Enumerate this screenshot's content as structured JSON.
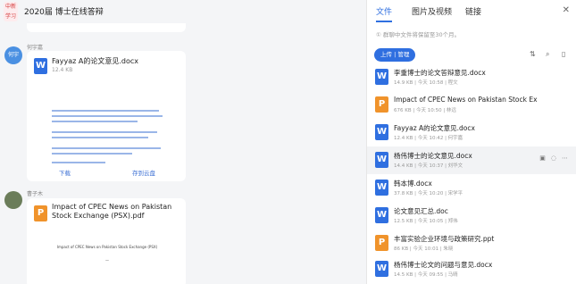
{
  "chat": {
    "group_avatar_text": "中新\n学习",
    "title": "2020届 博士在线答辩",
    "messages": [
      {
        "sender": "何宇嘉",
        "avatar_text": "何宇",
        "avatar_color": "#4a90e2",
        "file": {
          "type": "W",
          "name": "Fayyaz A的论文意见.docx",
          "size": "12.4 KB",
          "actions": [
            "下载",
            "存到云盘"
          ]
        }
      },
      {
        "sender": "曹子木",
        "avatar_color": "#6b7d5a",
        "file": {
          "type": "P",
          "name": "Impact of CPEC News on Pakistan Stock Exchange (PSX).pdf",
          "size": "",
          "preview_title": "Impact of CPEC News on Pakistan Stock Exchange (PSX)"
        }
      }
    ]
  },
  "panel": {
    "tabs": [
      "文件",
      "图片及视频",
      "链接"
    ],
    "active_tab": "文件",
    "notice": "① 群聊中文件将保留至30个月。",
    "upload_label": "上传 | 管理",
    "colors": {
      "accent": "#2f6fe0",
      "word": "#2f6fe0",
      "pdf": "#f0932b"
    },
    "files": [
      {
        "type": "W",
        "name": "李重博士的论文答辩意见.docx",
        "meta": "14.9 KB | 今天 10:58 | 程文"
      },
      {
        "type": "P",
        "name": "Impact of CPEC News on Pakistan Stock Exchange (PSX).pdf",
        "meta": "676 KB | 今天 10:50 | 林远"
      },
      {
        "type": "W",
        "name": "Fayyaz A的论文意见.docx",
        "meta": "12.4 KB | 今天 10:42 | 何宇嘉"
      },
      {
        "type": "W",
        "name": "杨伟博士的论文意见.docx",
        "meta": "14.4 KB | 今天 10:37 | 刘华文",
        "hover": true
      },
      {
        "type": "W",
        "name": "韩本博.docx",
        "meta": "37.8 KB | 今天 10:20 | 宋学平"
      },
      {
        "type": "W",
        "name": "论文意见汇总.doc",
        "meta": "12.5 KB | 今天 10:05 | 郑伟"
      },
      {
        "type": "P",
        "name": "丰富实验企业环境与政策研究.ppt",
        "meta": "86 KB | 今天 10:01 | 朱晓"
      },
      {
        "type": "W",
        "name": "杨伟博士论文的问题与意见.docx",
        "meta": "14.5 KB | 今天 09:55 | 马晴"
      }
    ]
  }
}
